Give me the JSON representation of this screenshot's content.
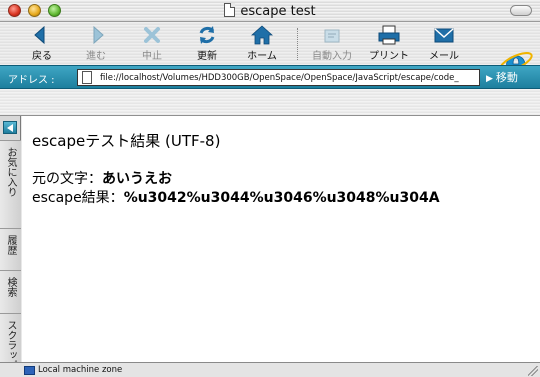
{
  "window": {
    "title": "escape test"
  },
  "toolbar": {
    "buttons": [
      {
        "label": "戻る",
        "icon": "back-arrow-icon",
        "enabled": true
      },
      {
        "label": "進む",
        "icon": "forward-arrow-icon",
        "enabled": false
      },
      {
        "label": "中止",
        "icon": "stop-x-icon",
        "enabled": false
      },
      {
        "label": "更新",
        "icon": "refresh-icon",
        "enabled": true
      },
      {
        "label": "ホーム",
        "icon": "home-icon",
        "enabled": true
      },
      {
        "label": "自動入力",
        "icon": "autofill-icon",
        "enabled": false
      },
      {
        "label": "プリント",
        "icon": "printer-icon",
        "enabled": true
      },
      {
        "label": "メール",
        "icon": "mail-icon",
        "enabled": true
      }
    ]
  },
  "address": {
    "label": "アドレス :",
    "url": "file://localhost/Volumes/HDD300GB/OpenSpace/OpenSpace/JavaScript/escape/code_",
    "go_label": "移動"
  },
  "sidebar": {
    "tabs": [
      "お気に入り",
      "履歴",
      "検索",
      "スクラップ"
    ]
  },
  "content": {
    "heading": "escapeテスト結果 (UTF-8)",
    "original_label": "元の文字：",
    "original_value": "あいうえお",
    "escape_label": "escape結果：",
    "escape_value": "%u3042%u3044%u3046%u3048%u304A"
  },
  "status": {
    "zone": "Local machine zone"
  },
  "colors": {
    "address_bar": "#1d7f9e",
    "toolbar_icon": "#1f6fa8"
  }
}
